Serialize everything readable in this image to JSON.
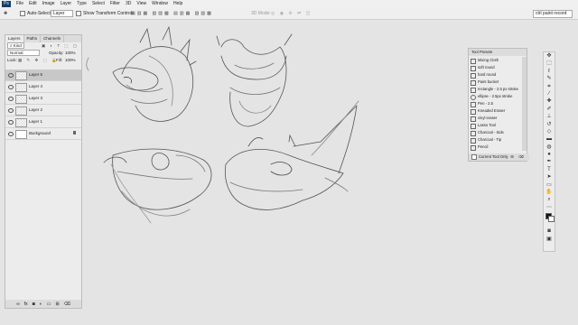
{
  "menubar": {
    "logo": "Ps",
    "items": [
      "File",
      "Edit",
      "Image",
      "Layer",
      "Type",
      "Select",
      "Filter",
      "3D",
      "View",
      "Window",
      "Help"
    ]
  },
  "options": {
    "auto_select_label": "Auto-Select:",
    "auto_select_value": "Layer",
    "show_transform": "Show Transform Controls",
    "mode_3d": "3D Mode:",
    "search_value": "ctrl paint record"
  },
  "layers_panel": {
    "tabs": [
      "Layers",
      "Paths",
      "Channels"
    ],
    "kind": "Kind",
    "blend": "Normal",
    "opacity_label": "Opacity:",
    "opacity_value": "100%",
    "lock_label": "Lock:",
    "fill_label": "Fill:",
    "fill_value": "100%",
    "layers": [
      "Layer 5",
      "Layer 4",
      "Layer 3",
      "Layer 2",
      "Layer 1",
      "Background"
    ],
    "footer_icons": [
      "link-icon",
      "fx-icon",
      "mask-icon",
      "adjustment-icon",
      "folder-icon",
      "new-layer-icon",
      "trash-icon"
    ]
  },
  "tool_presets": {
    "title": "Tool Presets",
    "items": [
      "Mixing Cloth",
      "soft round",
      "hard round",
      "Paint bucket",
      "rectangle - 2.5 px stroke",
      "ellipse - 2.5px stroke",
      "Pen - 2.5",
      "Kneaded Eraser",
      "vinyl eraser",
      "Lasso Tool",
      "Charcoal - Side",
      "Charcoal - Tip",
      "Pencil"
    ],
    "current_only": "Current Tool Only"
  },
  "colors": {
    "foreground": "#111111",
    "background": "#ffffff"
  }
}
